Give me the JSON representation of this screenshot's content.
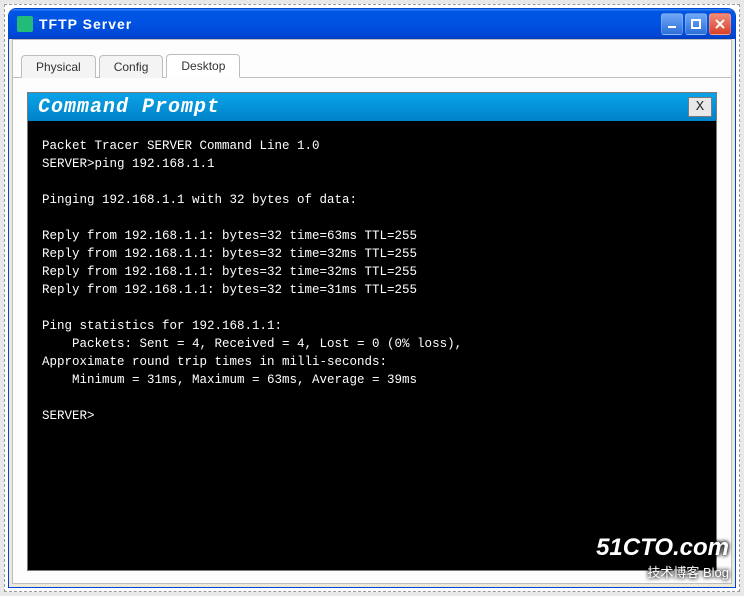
{
  "window": {
    "title": "TFTP Server"
  },
  "tabs": {
    "items": [
      {
        "label": "Physical",
        "active": false
      },
      {
        "label": "Config",
        "active": false
      },
      {
        "label": "Desktop",
        "active": true
      }
    ]
  },
  "prompt": {
    "title": "Command Prompt",
    "close_label": "X"
  },
  "terminal": {
    "lines": [
      "Packet Tracer SERVER Command Line 1.0",
      "SERVER>ping 192.168.1.1",
      "",
      "Pinging 192.168.1.1 with 32 bytes of data:",
      "",
      "Reply from 192.168.1.1: bytes=32 time=63ms TTL=255",
      "Reply from 192.168.1.1: bytes=32 time=32ms TTL=255",
      "Reply from 192.168.1.1: bytes=32 time=32ms TTL=255",
      "Reply from 192.168.1.1: bytes=32 time=31ms TTL=255",
      "",
      "Ping statistics for 192.168.1.1:",
      "    Packets: Sent = 4, Received = 4, Lost = 0 (0% loss),",
      "Approximate round trip times in milli-seconds:",
      "    Minimum = 31ms, Maximum = 63ms, Average = 39ms",
      "",
      "SERVER>"
    ]
  },
  "watermark": {
    "brand": "51CTO.com",
    "tagline": "技术博客    Blog"
  }
}
